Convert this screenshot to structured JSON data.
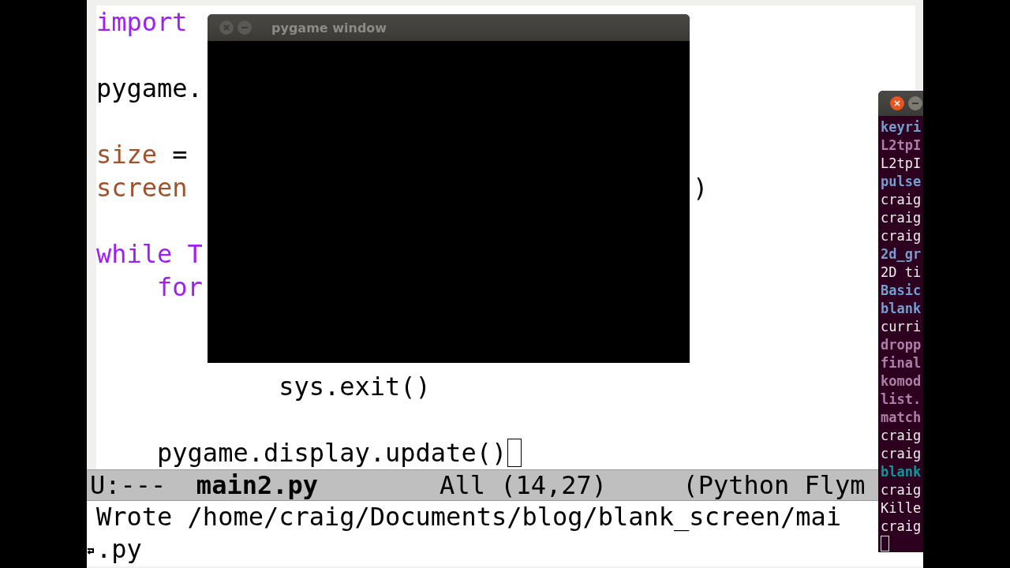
{
  "editor": {
    "lines": [
      {
        "kind": "code",
        "segments": [
          {
            "text": "import",
            "kind": "keyword"
          }
        ]
      },
      {
        "kind": "blank"
      },
      {
        "kind": "code",
        "segments": [
          {
            "text": "pygame.",
            "kind": "plain"
          }
        ]
      },
      {
        "kind": "blank"
      },
      {
        "kind": "code",
        "segments": [
          {
            "text": "size",
            "kind": "variable"
          },
          {
            "text": " =",
            "kind": "plain"
          }
        ]
      },
      {
        "kind": "code",
        "segments": [
          {
            "text": "screen",
            "kind": "variable"
          }
        ],
        "tail": ")"
      },
      {
        "kind": "blank"
      },
      {
        "kind": "code",
        "segments": [
          {
            "text": "while T",
            "kind": "keyword"
          }
        ]
      },
      {
        "kind": "code",
        "segments": [
          {
            "text": "    for",
            "kind": "keyword"
          }
        ]
      },
      {
        "kind": "blank"
      },
      {
        "kind": "blank"
      },
      {
        "kind": "code",
        "segments": [
          {
            "text": "            sys.exit()",
            "kind": "plain"
          }
        ]
      },
      {
        "kind": "blank"
      },
      {
        "kind": "code",
        "segments": [
          {
            "text": "    pygame.display.update()",
            "kind": "plain"
          }
        ],
        "cursor": true
      }
    ],
    "mode_line": "U:---  **main2.py**        All (14,27)     (Python Flym",
    "minibuffer": [
      "Wrote /home/craig/Documents/blog/blank_screen/mai",
      ".py"
    ]
  },
  "pygame_window": {
    "title": "pygame window"
  },
  "terminal": {
    "lines": [
      {
        "text": "keyri",
        "color": "#729fcf",
        "bold": true
      },
      {
        "text": "L2tpI",
        "color": "#ad7fa8",
        "bold": true
      },
      {
        "text": "L2tpI",
        "color": "#eeeeec",
        "bold": false
      },
      {
        "text": "pulse",
        "color": "#729fcf",
        "bold": true
      },
      {
        "text": "craig",
        "color": "#eeeeec",
        "bold": false
      },
      {
        "text": "craig",
        "color": "#eeeeec",
        "bold": false
      },
      {
        "text": "craig",
        "color": "#eeeeec",
        "bold": false
      },
      {
        "text": "2d_gr",
        "color": "#729fcf",
        "bold": true
      },
      {
        "text": "2D ti",
        "color": "#eeeeec",
        "bold": false
      },
      {
        "text": "Basic",
        "color": "#729fcf",
        "bold": true
      },
      {
        "text": "blank",
        "color": "#729fcf",
        "bold": true
      },
      {
        "text": "curri",
        "color": "#eeeeec",
        "bold": false
      },
      {
        "text": "dropp",
        "color": "#ad7fa8",
        "bold": true
      },
      {
        "text": "final",
        "color": "#ad7fa8",
        "bold": true
      },
      {
        "text": "komod",
        "color": "#ad7fa8",
        "bold": true
      },
      {
        "text": "list.",
        "color": "#ad7fa8",
        "bold": true
      },
      {
        "text": "match",
        "color": "#ad7fa8",
        "bold": true
      },
      {
        "text": "craig",
        "color": "#eeeeec",
        "bold": false
      },
      {
        "text": "craig",
        "color": "#eeeeec",
        "bold": false
      },
      {
        "text": "blank",
        "color": "#06989a",
        "bold": true
      },
      {
        "text": "craig",
        "color": "#eeeeec",
        "bold": false
      },
      {
        "text": "Kille",
        "color": "#eeeeec",
        "bold": false
      },
      {
        "text": "craig",
        "color": "#eeeeec",
        "bold": false
      }
    ]
  }
}
